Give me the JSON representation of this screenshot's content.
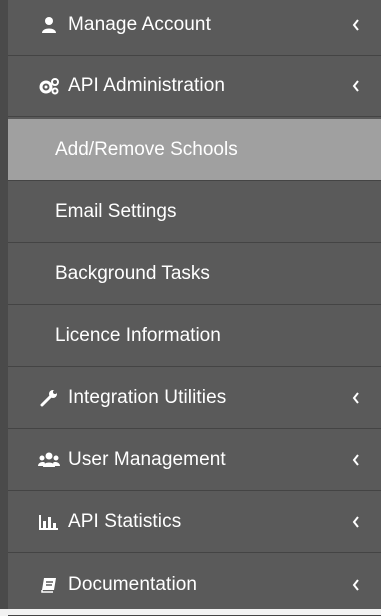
{
  "menu": {
    "manage_account": {
      "label": "Manage Account",
      "icon": "user-icon"
    },
    "api_administration": {
      "label": "API Administration",
      "icon": "cogs-icon"
    },
    "sub_items": [
      {
        "label": "Add/Remove Schools",
        "active": true
      },
      {
        "label": "Email Settings",
        "active": false
      },
      {
        "label": "Background Tasks",
        "active": false
      },
      {
        "label": "Licence Information",
        "active": false
      }
    ],
    "integration_utilities": {
      "label": "Integration Utilities",
      "icon": "wrench-icon"
    },
    "user_management": {
      "label": "User Management",
      "icon": "users-icon"
    },
    "api_statistics": {
      "label": "API Statistics",
      "icon": "bar-chart-icon"
    },
    "documentation": {
      "label": "Documentation",
      "icon": "book-icon"
    }
  },
  "colors": {
    "sidebar_bg": "#5a5a5a",
    "active_bg": "#a0a0a0",
    "text": "#ffffff",
    "divider": "#444444"
  }
}
